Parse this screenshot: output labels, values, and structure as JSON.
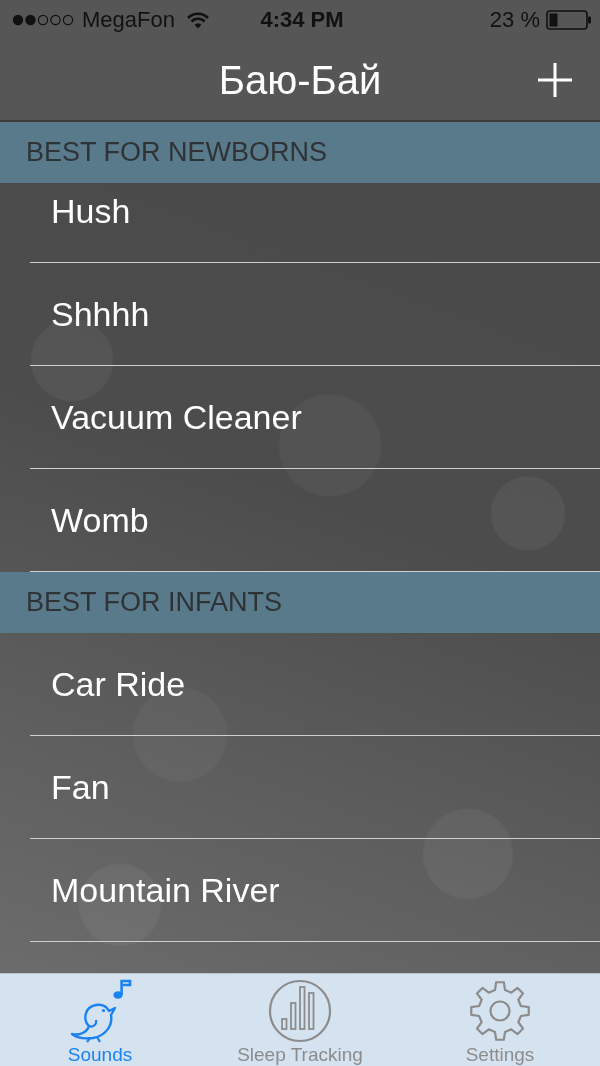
{
  "status_bar": {
    "carrier": "MegaFon",
    "time": "4:34 PM",
    "battery": "23 %"
  },
  "nav_bar": {
    "title": "Баю-Бай"
  },
  "sections": [
    {
      "title": "BEST FOR NEWBORNS",
      "items": [
        "Hush",
        "Shhhh",
        "Vacuum Cleaner",
        "Womb"
      ]
    },
    {
      "title": "BEST FOR INFANTS",
      "items": [
        "Car Ride",
        "Fan",
        "Mountain River"
      ]
    }
  ],
  "tab_bar": [
    {
      "kind": "sounds",
      "label": "Sounds",
      "selected": true
    },
    {
      "kind": "tracking",
      "label": "Sleep Tracking",
      "selected": false
    },
    {
      "kind": "settings",
      "label": "Settings",
      "selected": false
    }
  ]
}
